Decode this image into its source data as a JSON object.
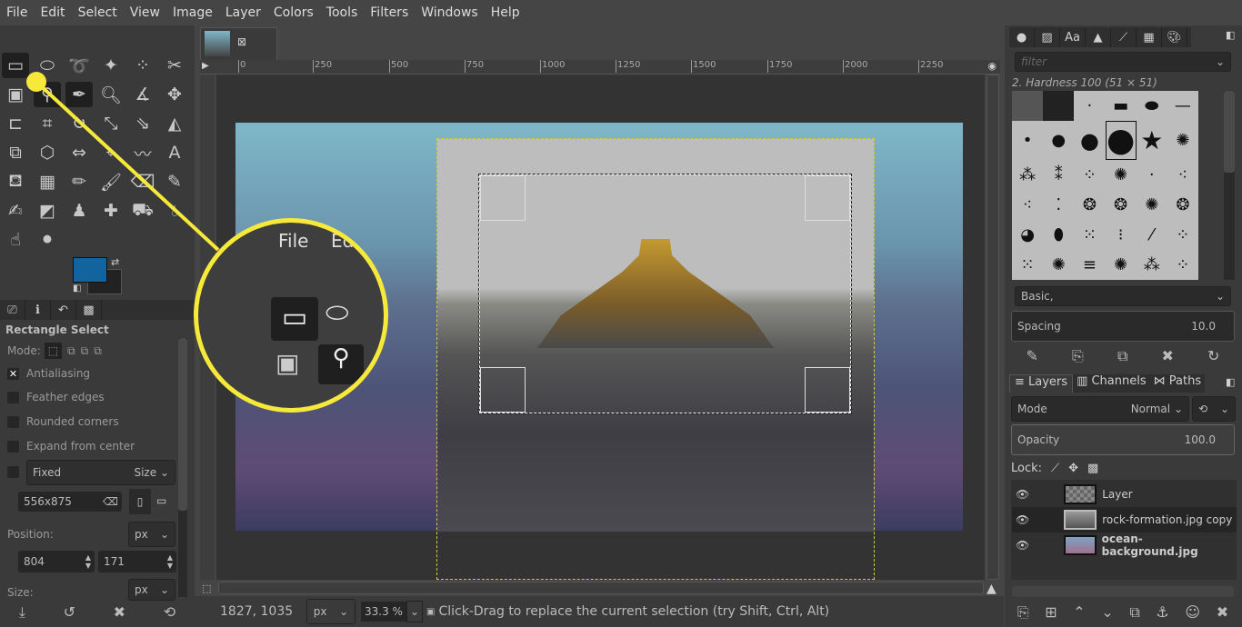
{
  "menu": [
    "File",
    "Edit",
    "Select",
    "View",
    "Image",
    "Layer",
    "Colors",
    "Tools",
    "Filters",
    "Windows",
    "Help"
  ],
  "colors": {
    "foreground": "#12649e",
    "background": "#222222",
    "callout": "#f6e93a"
  },
  "tool_options": {
    "title": "Rectangle Select",
    "mode_label": "Mode:",
    "antialiasing": "Antialiasing",
    "antialiasing_checked": true,
    "feather": "Feather edges",
    "rounded": "Rounded corners",
    "expand": "Expand from center",
    "fixed": "Fixed",
    "fixed_option": "Size",
    "fixed_value": "556x875",
    "position_label": "Position:",
    "position_unit": "px",
    "pos_x": "804",
    "pos_y": "171",
    "size_label": "Size:",
    "size_unit": "px"
  },
  "ruler": [
    "0",
    "250",
    "500",
    "750",
    "1000",
    "1250",
    "1500",
    "1750",
    "2000",
    "2250"
  ],
  "status": {
    "coords": "1827, 1035",
    "unit": "px",
    "zoom": "33.3 %",
    "message": "Click-Drag to replace the current selection (try Shift, Ctrl, Alt)"
  },
  "brushes": {
    "filter_placeholder": "filter",
    "selected": "2. Hardness 100 (51 × 51)",
    "tag": "Basic,",
    "spacing_label": "Spacing",
    "spacing": "10.0"
  },
  "layers": {
    "tabs": [
      "Layers",
      "Channels",
      "Paths"
    ],
    "mode_label": "Mode",
    "mode": "Normal",
    "opacity_label": "Opacity",
    "opacity": "100.0",
    "lock_label": "Lock:",
    "items": [
      {
        "name": "Layer"
      },
      {
        "name": "rock-formation.jpg copy"
      },
      {
        "name": "ocean-background.jpg"
      }
    ]
  },
  "callout": {
    "menu1": "File",
    "menu2": "Ed"
  }
}
